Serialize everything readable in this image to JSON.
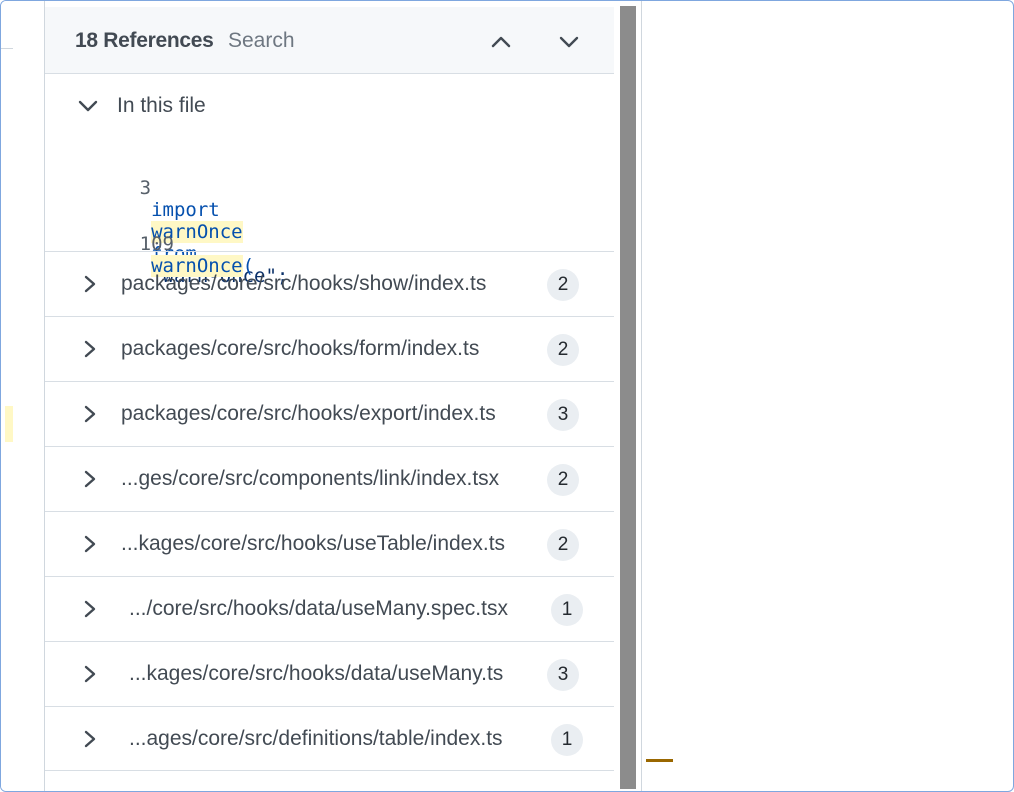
{
  "header": {
    "title": "18 References",
    "search_placeholder": "Search",
    "prev_icon": "chevron-up-icon",
    "next_icon": "chevron-down-icon"
  },
  "in_this_file": {
    "label": "In this file",
    "icon": "chevron-down-icon",
    "lines": [
      {
        "number": "3",
        "tokens": [
          "import",
          "warnOnce",
          "from",
          "\"warn-once\";"
        ]
      },
      {
        "number": "109",
        "tokens": [
          "warnOnce",
          "("
        ]
      }
    ]
  },
  "files": [
    {
      "path": "packages/core/src/hooks/show/index.ts",
      "count": "2"
    },
    {
      "path": "packages/core/src/hooks/form/index.ts",
      "count": "2"
    },
    {
      "path": "packages/core/src/hooks/export/index.ts",
      "count": "3"
    },
    {
      "path": "...ges/core/src/components/link/index.tsx",
      "count": "2"
    },
    {
      "path": "...kages/core/src/hooks/useTable/index.ts",
      "count": "2"
    },
    {
      "path": ".../core/src/hooks/data/useMany.spec.tsx",
      "count": "1"
    },
    {
      "path": "...kages/core/src/hooks/data/useMany.ts",
      "count": "3"
    },
    {
      "path": "...ages/core/src/definitions/table/index.ts",
      "count": "1"
    }
  ],
  "colors": {
    "keyword": "#0550ae",
    "highlight": "#fff8c5",
    "scrollbar": "#8c8c8c",
    "badge_bg": "#eaeef2"
  }
}
